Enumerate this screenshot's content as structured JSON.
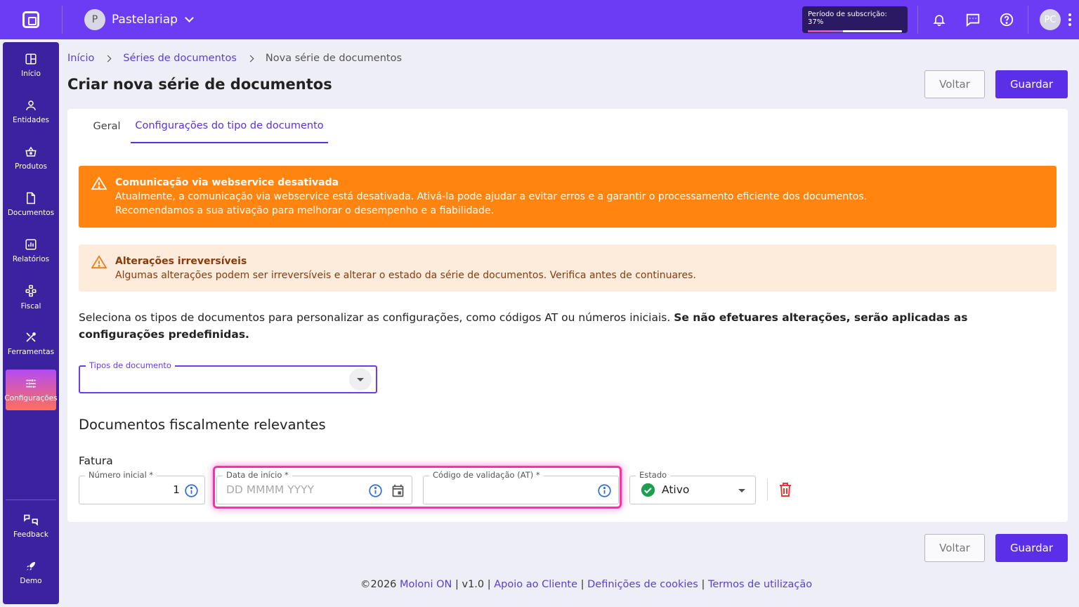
{
  "topbar": {
    "company_initial": "P",
    "company_name": "Pastelariap",
    "subscription_label": "Período de subscrição: 37%",
    "subscription_progress": 0.37,
    "user_initials": "PC",
    "icons": [
      "bell-icon",
      "chat-icon",
      "help-icon"
    ]
  },
  "sidebar": {
    "items": [
      {
        "label": "Início",
        "icon": "dashboard-icon"
      },
      {
        "label": "Entidades",
        "icon": "person-icon"
      },
      {
        "label": "Produtos",
        "icon": "basket-icon"
      },
      {
        "label": "Documentos",
        "icon": "document-icon"
      },
      {
        "label": "Relatórios",
        "icon": "report-icon"
      },
      {
        "label": "Fiscal",
        "icon": "fiscal-icon"
      },
      {
        "label": "Ferramentas",
        "icon": "tools-icon"
      },
      {
        "label": "Configurações",
        "icon": "settings-icon"
      }
    ],
    "bottom_items": [
      {
        "label": "Feedback",
        "icon": "feedback-icon"
      },
      {
        "label": "Demo",
        "icon": "rocket-icon"
      }
    ]
  },
  "breadcrumb": {
    "home": "Início",
    "parent": "Séries de documentos",
    "current": "Nova série de documentos"
  },
  "page": {
    "title": "Criar nova série de documentos",
    "back_label": "Voltar",
    "save_label": "Guardar"
  },
  "tabs": [
    {
      "label": "Geral",
      "active": false
    },
    {
      "label": "Configurações do tipo de documento",
      "active": true
    }
  ],
  "alerts": {
    "webservice": {
      "title": "Comunicação via webservice desativada",
      "line1": "Atualmente, a comunicação via webservice está desativada. Ativá-la pode ajudar a evitar erros e a garantir o processamento eficiente dos documentos.",
      "line2": "Recomendamos a sua ativação para melhorar o desempenho e a fiabilidade."
    },
    "irreversible": {
      "title": "Alterações irreversíveis",
      "text": "Algumas alterações podem ser irreversíveis e alterar o estado da série de documentos. Verifica antes de continuares."
    }
  },
  "description": {
    "normal": "Seleciona os tipos de documentos para personalizar as configurações, como códigos AT ou números iniciais. ",
    "bold": "Se não efetuares alterações, serão aplicadas as configurações predefinidas."
  },
  "doc_types_field": {
    "label": "Tipos de documento",
    "value": ""
  },
  "section": {
    "title": "Documentos fiscalmente relevantes",
    "doc_name": "Fatura",
    "initial_number_label": "Número inicial *",
    "initial_number_value": "1",
    "start_date_label": "Data de início *",
    "start_date_placeholder": "DD MMMM YYYY",
    "validation_code_label": "Código de validação (AT) *",
    "validation_code_value": "",
    "state_label": "Estado",
    "state_value": "Ativo"
  },
  "footer": {
    "copyright": "©2026 ",
    "brand": "Moloni ON",
    "version": " | v1.0 | ",
    "support": "Apoio ao Cliente",
    "sep": " | ",
    "cookies": "Definições de cookies",
    "terms": "Termos de utilização"
  },
  "colors": {
    "brand": "#6b3cf4",
    "sidebar": "#3d22a0",
    "primary_button": "#5b2ee8",
    "warning": "#ff8410",
    "warning_light": "#fdebdc",
    "success": "#1e9e4f",
    "danger": "#e53935",
    "highlight": "#ff2fa8"
  }
}
